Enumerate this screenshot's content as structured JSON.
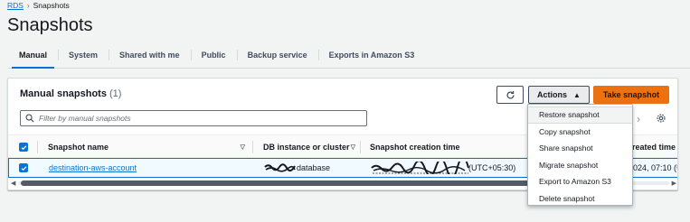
{
  "breadcrumb": {
    "root": "RDS",
    "current": "Snapshots"
  },
  "page": {
    "title": "Snapshots"
  },
  "tabs": [
    {
      "label": "Manual",
      "active": true
    },
    {
      "label": "System"
    },
    {
      "label": "Shared with me"
    },
    {
      "label": "Public"
    },
    {
      "label": "Backup service"
    },
    {
      "label": "Exports in Amazon S3"
    }
  ],
  "panel": {
    "title": "Manual snapshots",
    "count": "(1)",
    "actions_label": "Actions",
    "take_snapshot_label": "Take snapshot",
    "filter_placeholder": "Filter by manual snapshots"
  },
  "table": {
    "columns": {
      "name": "Snapshot name",
      "db_instance": "DB instance or cluster",
      "creation_time": "Snapshot creation time",
      "db_created_time": "reated time"
    },
    "rows": [
      {
        "name": "destination-aws-account",
        "db_instance": "database",
        "creation_time": "(UTC+05:30)",
        "db_created_time": "024, 07:10 (U"
      }
    ]
  },
  "actions_menu": {
    "items": [
      "Restore snapshot",
      "Copy snapshot",
      "Share snapshot",
      "Migrate snapshot",
      "Export to Amazon S3",
      "Delete snapshot"
    ]
  },
  "colors": {
    "accent": "#0972d3",
    "primary_button": "#ec7211",
    "background": "#f2f3f3"
  }
}
